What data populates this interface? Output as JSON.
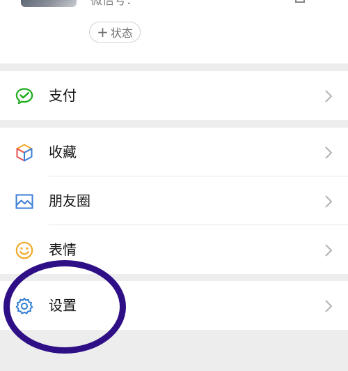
{
  "profile": {
    "wechat_id_partial": "微信号：",
    "status_label": "状态",
    "status_plus": "+"
  },
  "menu": {
    "pay": {
      "label": "支付",
      "icon": "wechat-pay-icon"
    },
    "favorites": {
      "label": "收藏",
      "icon": "cube-icon"
    },
    "moments": {
      "label": "朋友圈",
      "icon": "image-icon"
    },
    "stickers": {
      "label": "表情",
      "icon": "smiley-icon"
    },
    "settings": {
      "label": "设置",
      "icon": "gear-icon"
    }
  },
  "colors": {
    "background": "#ededed",
    "pay_green": "#1aad19",
    "moments_blue": "#3b7dd8",
    "stickers_yellow": "#f0a92a",
    "settings_blue": "#2b7ad0",
    "annotation_purple": "#2f0f86"
  }
}
